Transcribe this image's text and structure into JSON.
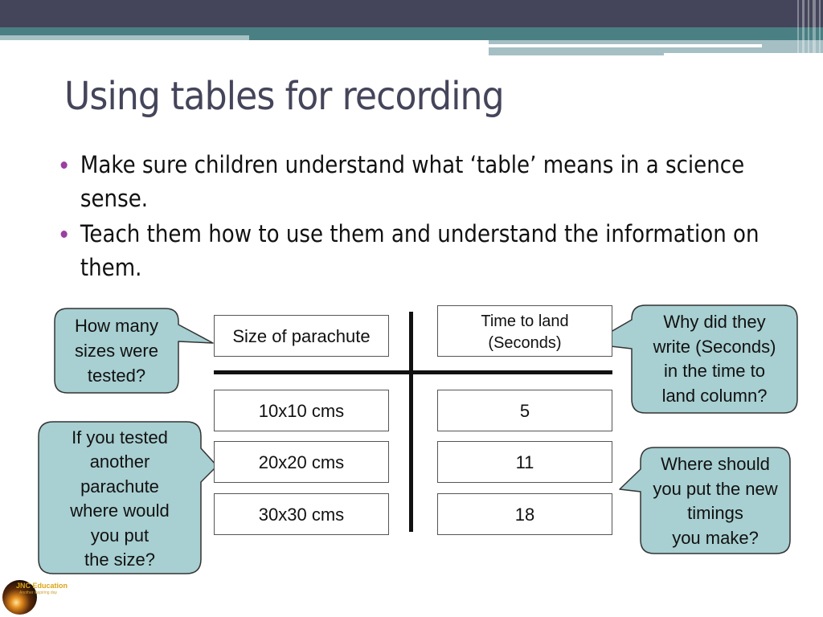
{
  "slide": {
    "title": "Using tables for recording",
    "bullets": [
      "Make sure children understand what ‘table’ means in a science sense.",
      "Teach them how to use them and understand the information on them."
    ]
  },
  "table": {
    "headers": [
      "Size of parachute",
      "Time to land (Seconds)"
    ],
    "header_lines": {
      "time": [
        "Time to land",
        "(Seconds)"
      ]
    },
    "rows": [
      {
        "size": "10x10 cms",
        "time": "5"
      },
      {
        "size": "20x20 cms",
        "time": "11"
      },
      {
        "size": "30x30 cms",
        "time": "18"
      }
    ]
  },
  "callouts": {
    "sizes_tested": [
      "How many",
      "sizes were",
      "tested?"
    ],
    "another_parachute": [
      "If you tested",
      "another",
      "parachute",
      "where would",
      "you put",
      "the size?"
    ],
    "why_seconds": [
      "Why did they",
      "write (Seconds)",
      "in the time to",
      "land column?"
    ],
    "new_timings": [
      "Where should",
      "you put the new",
      "timings",
      "you make?"
    ]
  },
  "logo": {
    "name": "JNC Education",
    "tagline": "Another inspiring day",
    "icon": "sunrise-globe-icon"
  },
  "colors": {
    "header_dark": "#44455a",
    "header_teal": "#4a8083",
    "callout_fill": "#a8cfd1",
    "bullet": "#9b3fa0",
    "title": "#44455a"
  }
}
